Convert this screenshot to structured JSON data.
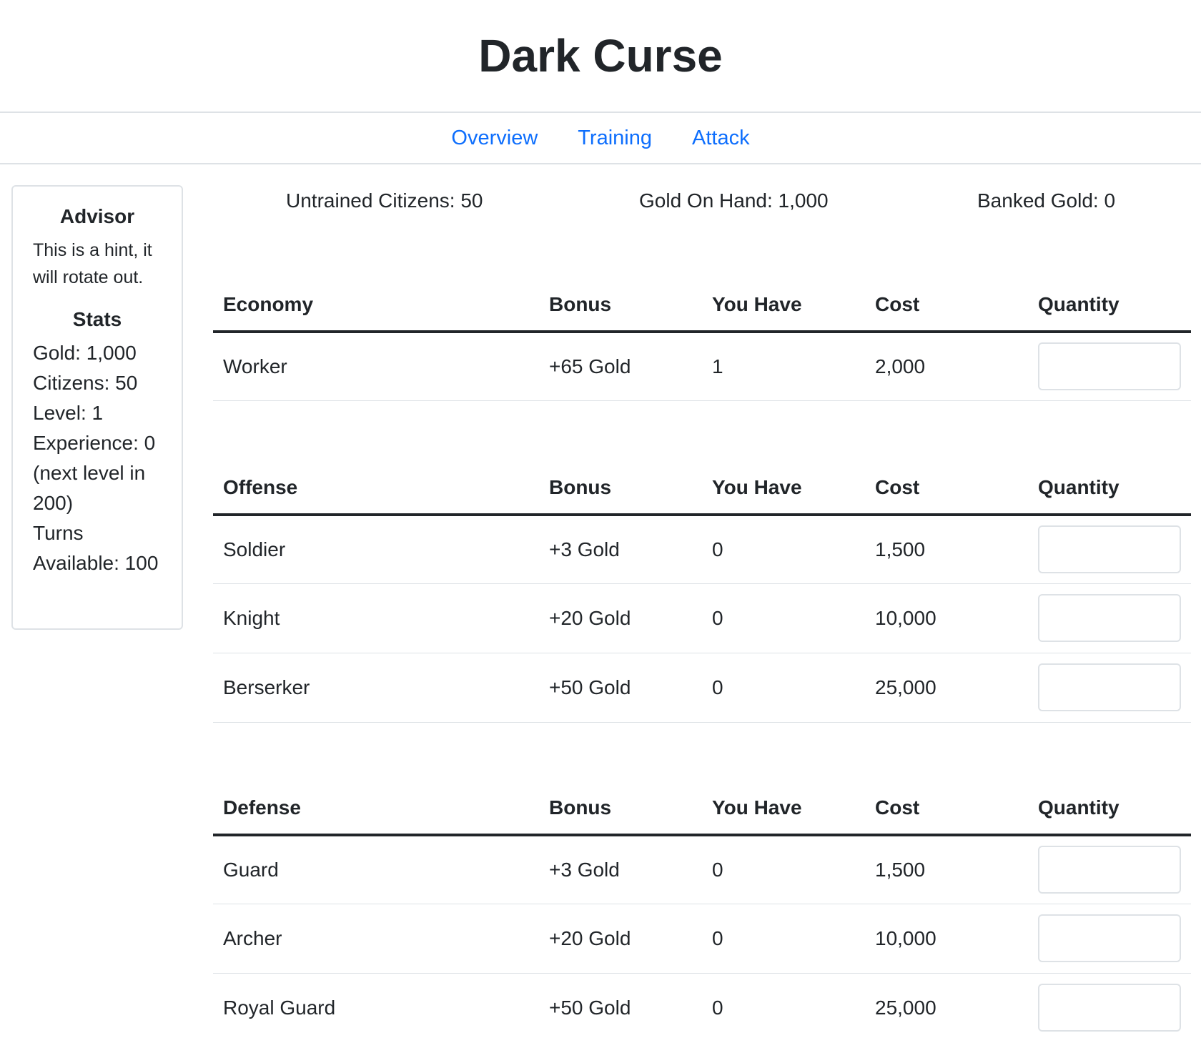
{
  "app": {
    "title": "Dark Curse"
  },
  "nav": [
    {
      "label": "Overview"
    },
    {
      "label": "Training"
    },
    {
      "label": "Attack"
    }
  ],
  "sidebar": {
    "advisor_heading": "Advisor",
    "hint": "This is a hint, it will rotate out.",
    "stats_heading": "Stats",
    "stats": [
      "Gold: 1,000",
      "Citizens: 50",
      "Level: 1",
      "Experience: 0 (next level in 200)",
      "Turns Available: 100"
    ]
  },
  "summary": {
    "untrained": "Untrained Citizens: 50",
    "gold": "Gold On Hand: 1,000",
    "banked": "Banked Gold: 0"
  },
  "columns": {
    "bonus": "Bonus",
    "have": "You Have",
    "cost": "Cost",
    "qty": "Quantity"
  },
  "tables": [
    {
      "heading": "Economy",
      "rows": [
        {
          "name": "Worker",
          "bonus": "+65 Gold",
          "have": "1",
          "cost": "2,000",
          "qty": ""
        }
      ]
    },
    {
      "heading": "Offense",
      "rows": [
        {
          "name": "Soldier",
          "bonus": "+3 Gold",
          "have": "0",
          "cost": "1,500",
          "qty": ""
        },
        {
          "name": "Knight",
          "bonus": "+20 Gold",
          "have": "0",
          "cost": "10,000",
          "qty": ""
        },
        {
          "name": "Berserker",
          "bonus": "+50 Gold",
          "have": "0",
          "cost": "25,000",
          "qty": ""
        }
      ]
    },
    {
      "heading": "Defense",
      "rows": [
        {
          "name": "Guard",
          "bonus": "+3 Gold",
          "have": "0",
          "cost": "1,500",
          "qty": ""
        },
        {
          "name": "Archer",
          "bonus": "+20 Gold",
          "have": "0",
          "cost": "10,000",
          "qty": ""
        },
        {
          "name": "Royal Guard",
          "bonus": "+50 Gold",
          "have": "0",
          "cost": "25,000",
          "qty": ""
        }
      ]
    }
  ],
  "colors": {
    "link": "#0d6efd",
    "text": "#212529",
    "border": "#dee2e6"
  }
}
